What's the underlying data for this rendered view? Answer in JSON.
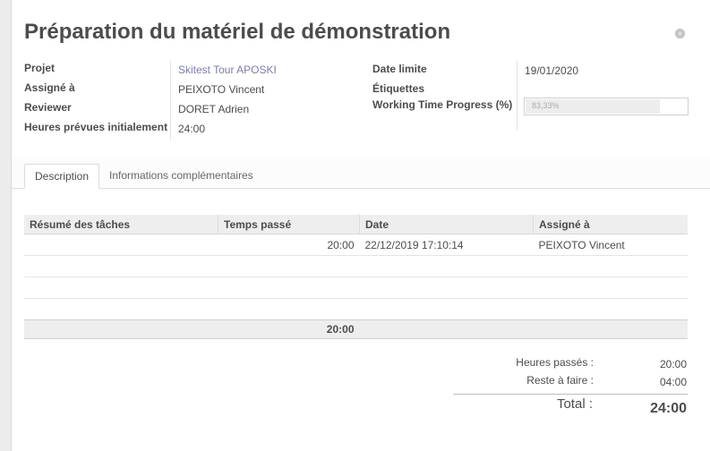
{
  "form": {
    "title": "Préparation du matériel de démonstration"
  },
  "fields": {
    "project_label": "Projet",
    "project_value": "Skitest Tour APOSKI",
    "assigned_label": "Assigné à",
    "assigned_value": "PEIXOTO Vincent",
    "reviewer_label": "Reviewer",
    "reviewer_value": "DORET Adrien",
    "planned_hours_label": "Heures prévues initialement",
    "planned_hours_value": "24:00",
    "deadline_label": "Date limite",
    "deadline_value": "19/01/2020",
    "tags_label": "Étiquettes",
    "progress_label": "Working Time Progress (%)",
    "progress_text": "83,33%",
    "progress_percent": 83.33
  },
  "tabs": [
    {
      "label": "Description"
    },
    {
      "label": "Informations complémentaires"
    }
  ],
  "table": {
    "headers": [
      "Résumé des tâches",
      "Temps passé",
      "Date",
      "Assigné à"
    ],
    "rows": [
      {
        "summary": "",
        "time": "20:00",
        "date": "22/12/2019 17:10:14",
        "assigned": "PEIXOTO Vincent"
      }
    ],
    "footer_total": "20:00"
  },
  "summary": {
    "spent_label": "Heures passés :",
    "spent_value": "20:00",
    "remaining_label": "Reste à faire :",
    "remaining_value": "04:00",
    "total_label": "Total :",
    "total_value": "24:00"
  }
}
